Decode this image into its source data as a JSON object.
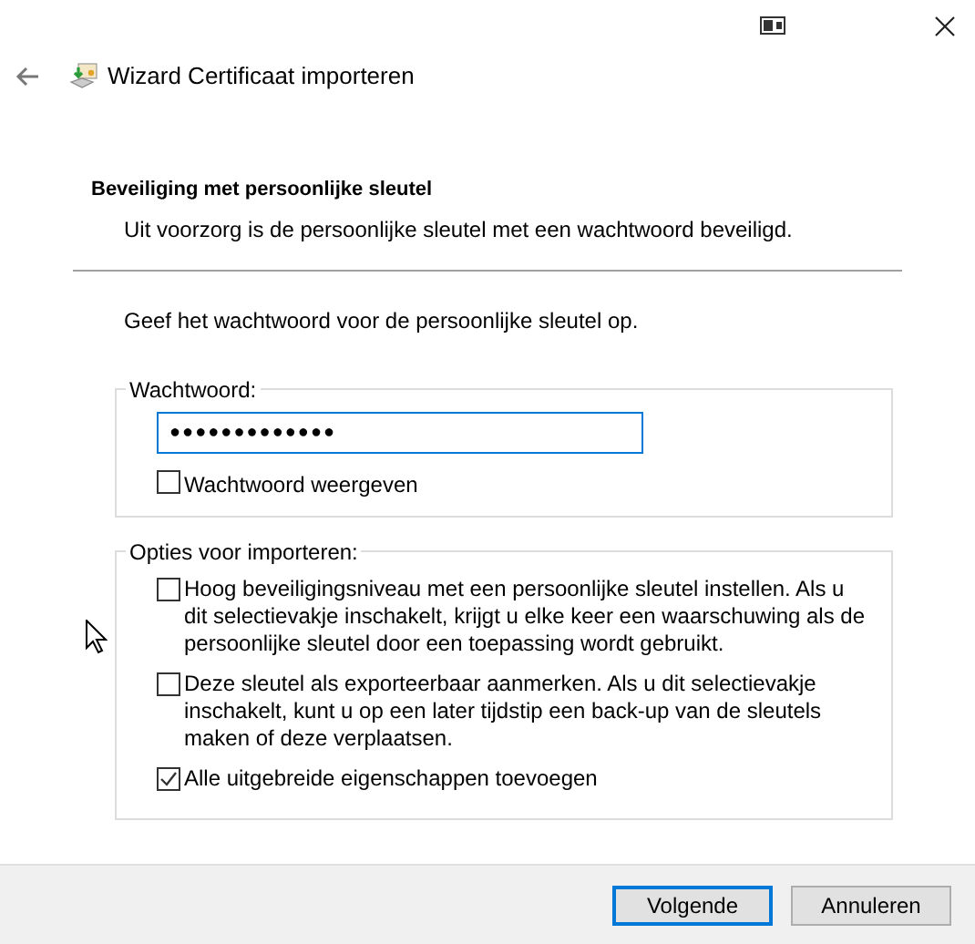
{
  "window": {
    "title": "Wizard Certificaat importeren"
  },
  "heading": "Beveiliging met persoonlijke sleutel",
  "subtitle": "Uit voorzorg is de persoonlijke sleutel met een wachtwoord beveiligd.",
  "prompt": "Geef het wachtwoord voor de persoonlijke sleutel op.",
  "password_group": {
    "legend": "Wachtwoord:",
    "value": "●●●●●●●●●●●●●",
    "focused": true,
    "show_password": {
      "label": "Wachtwoord weergeven",
      "checked": false
    }
  },
  "options_group": {
    "legend": "Opties voor importeren:",
    "options": [
      {
        "label": "Hoog beveiligingsniveau met een persoonlijke sleutel instellen. Als u dit selectievakje inschakelt, krijgt u elke keer een waarschuwing als de persoonlijke sleutel door een toepassing wordt gebruikt.",
        "checked": false
      },
      {
        "label": "Deze sleutel als exporteerbaar aanmerken. Als u dit selectievakje inschakelt, kunt u op een later tijdstip een back-up van de sleutels maken of deze verplaatsen.",
        "checked": false
      },
      {
        "label": "Alle uitgebreide eigenschappen toevoegen",
        "checked": true
      }
    ]
  },
  "buttons": [
    {
      "label": "Volgende",
      "default": true
    },
    {
      "label": "Annuleren",
      "default": false
    }
  ]
}
